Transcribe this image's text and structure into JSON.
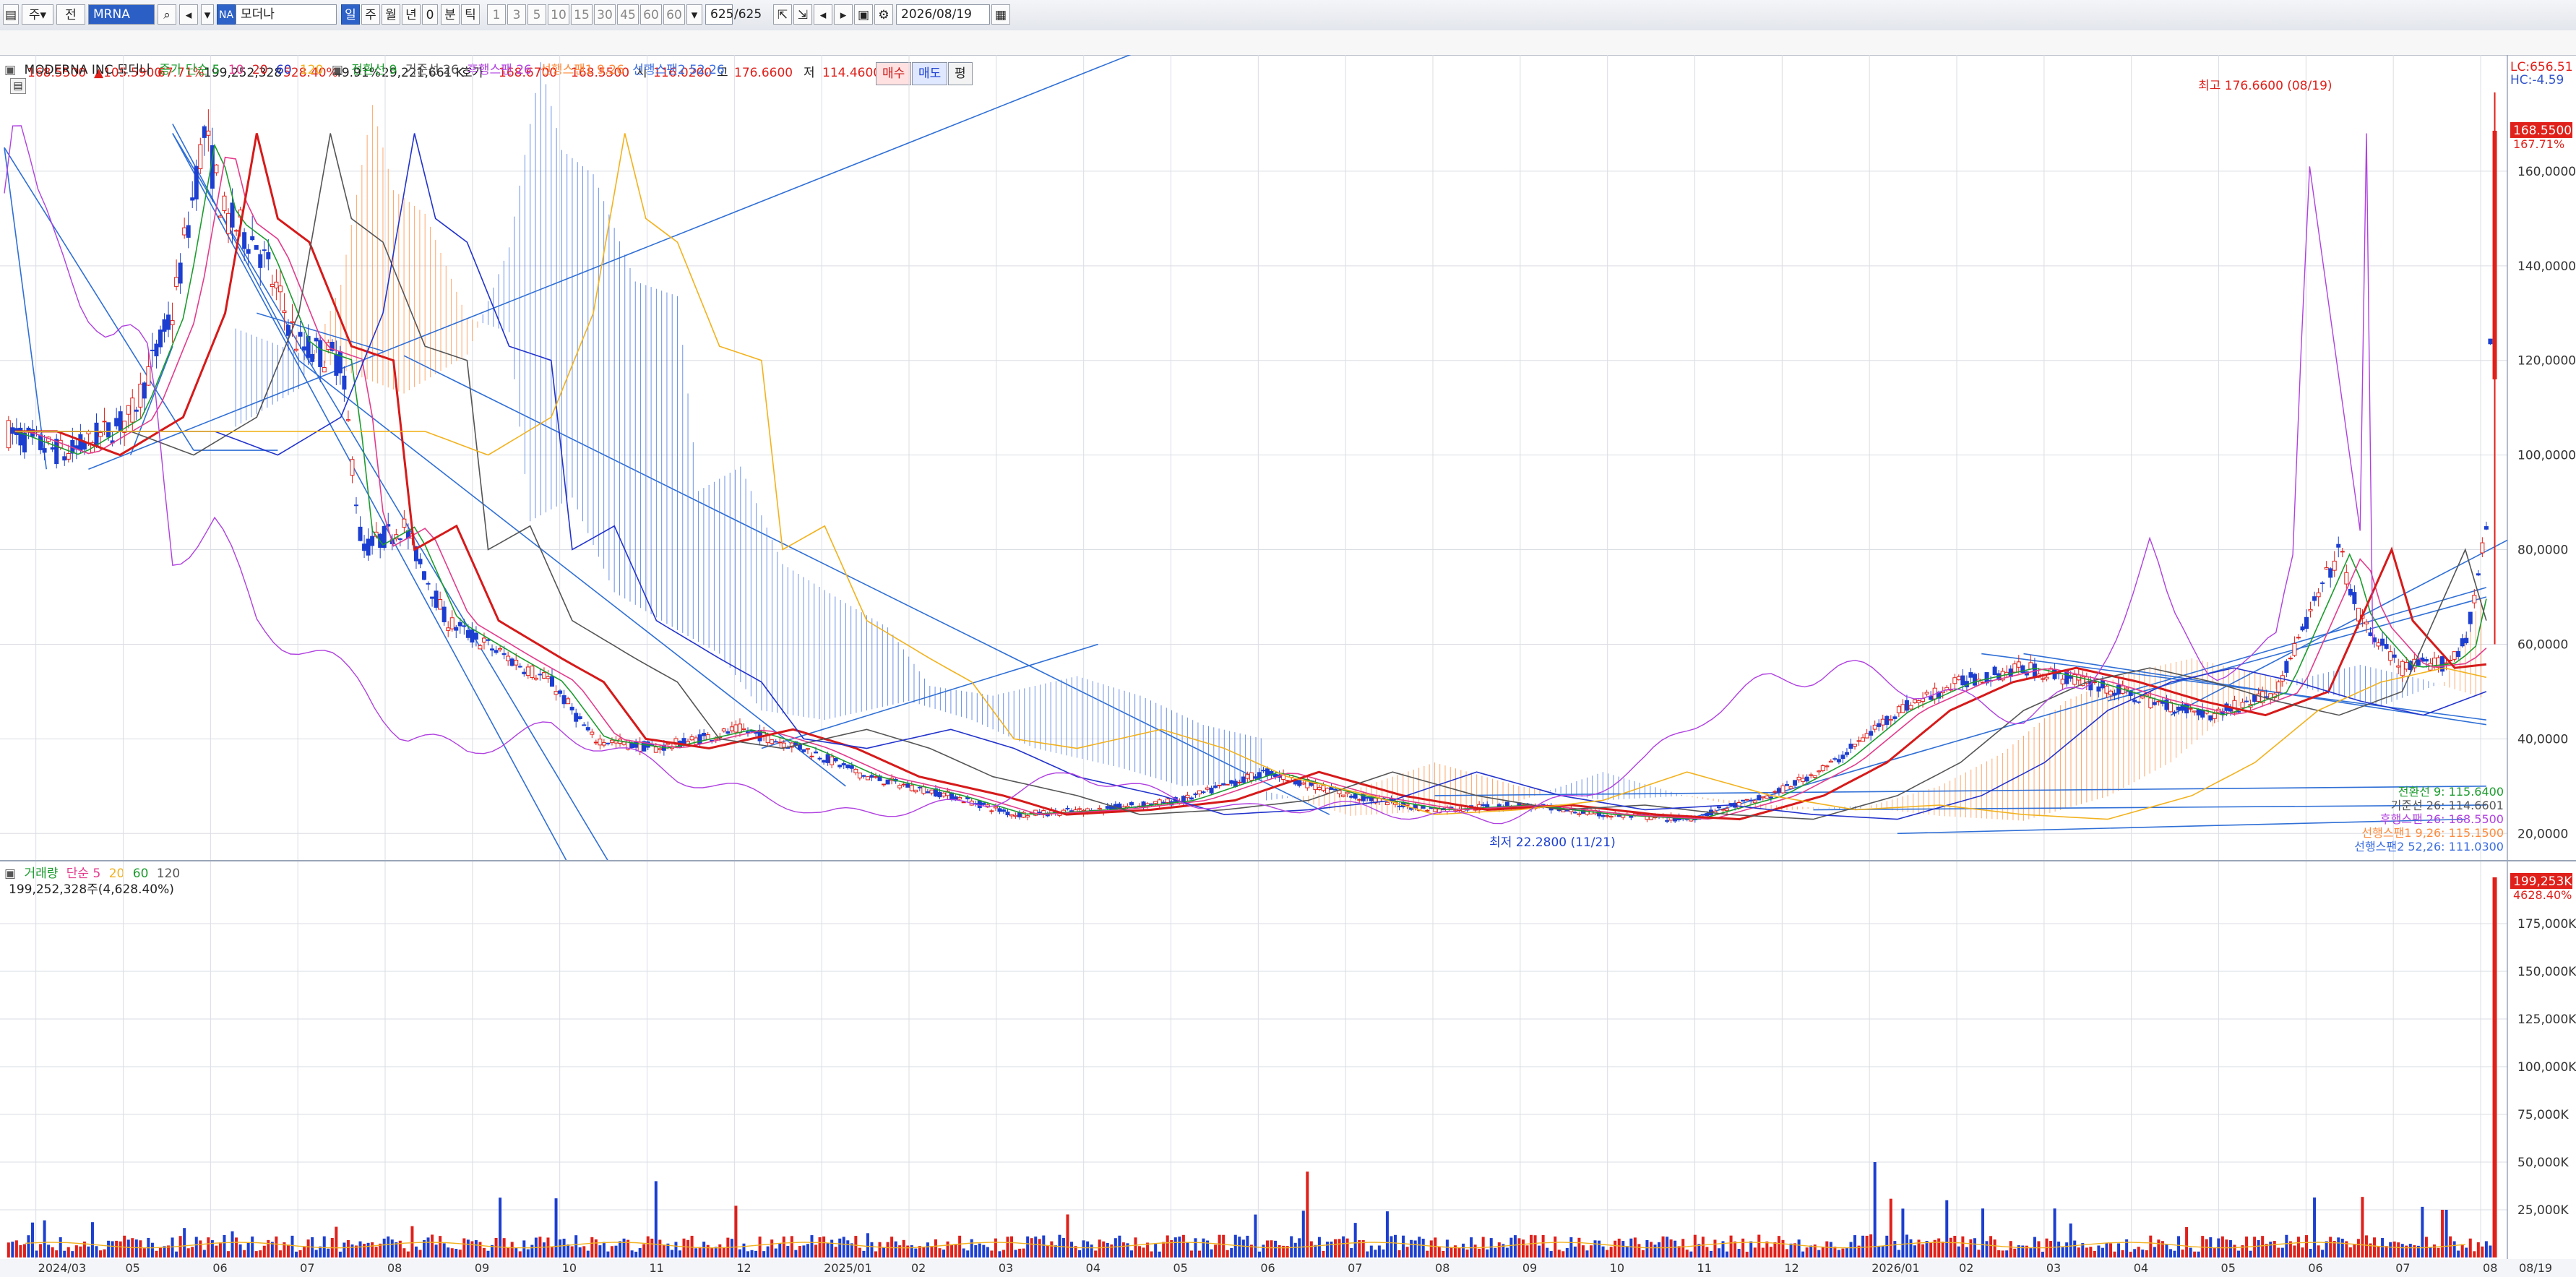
{
  "toolbar": {
    "btn_ju": "주",
    "btn_jeon": "전",
    "code": "MRNA",
    "code_badge": "NA",
    "name": "모더나",
    "period_tabs": [
      "일",
      "주",
      "월",
      "년",
      "0",
      "분",
      "틱"
    ],
    "minute_opts": [
      "1",
      "3",
      "5",
      "10",
      "15",
      "30",
      "45",
      "60",
      "60"
    ],
    "count": "625",
    "count_total": "/625",
    "date": "2026/08/19"
  },
  "quote": {
    "price": "168.5500",
    "change": "▲105.5900",
    "change_pct": "67.71%",
    "volume": "199,252,328",
    "vol_pct": "528.40%",
    "turnover_pct": "49.91%",
    "amount": "29,221,661 K",
    "hoga_label": "호가",
    "ask": "168.6700",
    "bid": "168.5500",
    "open_label": "시",
    "open": "116.0200",
    "high_label": "고",
    "high": "176.6600",
    "low_label": "저",
    "low": "114.4600",
    "buy_btn": "매수",
    "sell_btn": "매도",
    "eval_btn": "평"
  },
  "price_legend": {
    "title": "MODERNA INC  모더나",
    "ma_label": "종가 단순 5",
    "ma10": "10",
    "ma20": "20",
    "ma60": "60",
    "ma120": "120",
    "ich1": "전환선 9",
    "ich2": "기준선 26",
    "ich3": "후행스팬 26",
    "ich4": "선행스팬1 9,26",
    "ich5": "선행스팬2 52,26"
  },
  "volume_legend": {
    "title": "거래량",
    "ma_label": "단순 5",
    "ma20": "20",
    "ma60": "60",
    "ma120": "120",
    "value": "199,252,328주(4,628.40%)"
  },
  "annotations": {
    "high": "최고 176.6600 (08/19)",
    "low": "최저 22.2800 (11/21)",
    "lc": "LC:656.51",
    "hc": "HC:-4.59",
    "price_tag": "168.5500",
    "price_tag_pct": "167.71%",
    "vol_tag": "199,253K",
    "vol_tag_pct": "4628.40%",
    "ich_values": [
      "전환선 9: 115.6400",
      "기준선 26: 114.6601",
      "후행스팬 26: 168.5500",
      "선행스팬1 9,26: 115.1500",
      "선행스팬2 52,26: 111.0300"
    ]
  },
  "colors": {
    "ma5": "#1c9c2e",
    "ma10": "#e33b8c",
    "ma20": "#d61a1a",
    "ma60": "#2233cc",
    "ma120": "#f2b21e",
    "up": "#e0201a",
    "down": "#1c3fd0",
    "trend": "#2f6fd6",
    "lagging": "#b040e0",
    "cloud_up": "#ff8a3a",
    "cloud_dn": "#3a6de0"
  },
  "chart_data": {
    "type": "candlestick",
    "title": "MODERNA INC 모더나",
    "price_axis": {
      "ticks": [
        "20,0000",
        "40,0000",
        "60,0000",
        "80,0000",
        "100,0000",
        "120,0000",
        "140,0000",
        "160,0000"
      ],
      "ylim": [
        15,
        180
      ]
    },
    "volume_axis": {
      "ticks": [
        "25,000K",
        "50,000K",
        "75,000K",
        "100,000K",
        "125,000K",
        "150,000K",
        "175,000K"
      ],
      "ylim": [
        0,
        200000
      ]
    },
    "x_labels": [
      "2024/03",
      "05",
      "06",
      "07",
      "08",
      "09",
      "10",
      "11",
      "12",
      "2025/01",
      "02",
      "03",
      "04",
      "05",
      "06",
      "07",
      "08",
      "09",
      "10",
      "11",
      "12",
      "2026/01",
      "02",
      "03",
      "04",
      "05",
      "06",
      "07",
      "08"
    ],
    "x_end_label": "08/19",
    "close_series": [
      {
        "t": 0,
        "v": 105
      },
      {
        "t": 3,
        "v": 100
      },
      {
        "t": 6,
        "v": 108
      },
      {
        "t": 8,
        "v": 130
      },
      {
        "t": 9.5,
        "v": 168
      },
      {
        "t": 10.5,
        "v": 150
      },
      {
        "t": 12,
        "v": 145
      },
      {
        "t": 14,
        "v": 123
      },
      {
        "t": 16,
        "v": 120
      },
      {
        "t": 17,
        "v": 80
      },
      {
        "t": 19,
        "v": 85
      },
      {
        "t": 21,
        "v": 65
      },
      {
        "t": 24,
        "v": 57
      },
      {
        "t": 26,
        "v": 52
      },
      {
        "t": 28,
        "v": 40
      },
      {
        "t": 31,
        "v": 38
      },
      {
        "t": 35,
        "v": 42
      },
      {
        "t": 38,
        "v": 38
      },
      {
        "t": 41,
        "v": 32
      },
      {
        "t": 45,
        "v": 28
      },
      {
        "t": 48,
        "v": 24
      },
      {
        "t": 52,
        "v": 25
      },
      {
        "t": 56,
        "v": 27
      },
      {
        "t": 60,
        "v": 33
      },
      {
        "t": 64,
        "v": 28
      },
      {
        "t": 68,
        "v": 25
      },
      {
        "t": 72,
        "v": 26
      },
      {
        "t": 76,
        "v": 24
      },
      {
        "t": 80,
        "v": 23
      },
      {
        "t": 84,
        "v": 28
      },
      {
        "t": 87,
        "v": 35
      },
      {
        "t": 90,
        "v": 46
      },
      {
        "t": 93,
        "v": 52
      },
      {
        "t": 96,
        "v": 55
      },
      {
        "t": 99,
        "v": 52
      },
      {
        "t": 102,
        "v": 48
      },
      {
        "t": 105,
        "v": 45
      },
      {
        "t": 108,
        "v": 50
      },
      {
        "t": 110,
        "v": 70
      },
      {
        "t": 111,
        "v": 80
      },
      {
        "t": 112,
        "v": 65
      },
      {
        "t": 114,
        "v": 55
      },
      {
        "t": 116,
        "v": 56
      },
      {
        "t": 117,
        "v": 60
      },
      {
        "t": 118,
        "v": 84
      },
      {
        "t": 118.4,
        "v": 168.55
      }
    ],
    "volume_spikes": [
      {
        "t": 31,
        "v": 40000
      },
      {
        "t": 62,
        "v": 45000
      },
      {
        "t": 89,
        "v": 50000
      },
      {
        "t": 116,
        "v": 25000
      },
      {
        "t": 118.4,
        "v": 199252
      }
    ],
    "high": 176.66,
    "low": 22.28
  }
}
